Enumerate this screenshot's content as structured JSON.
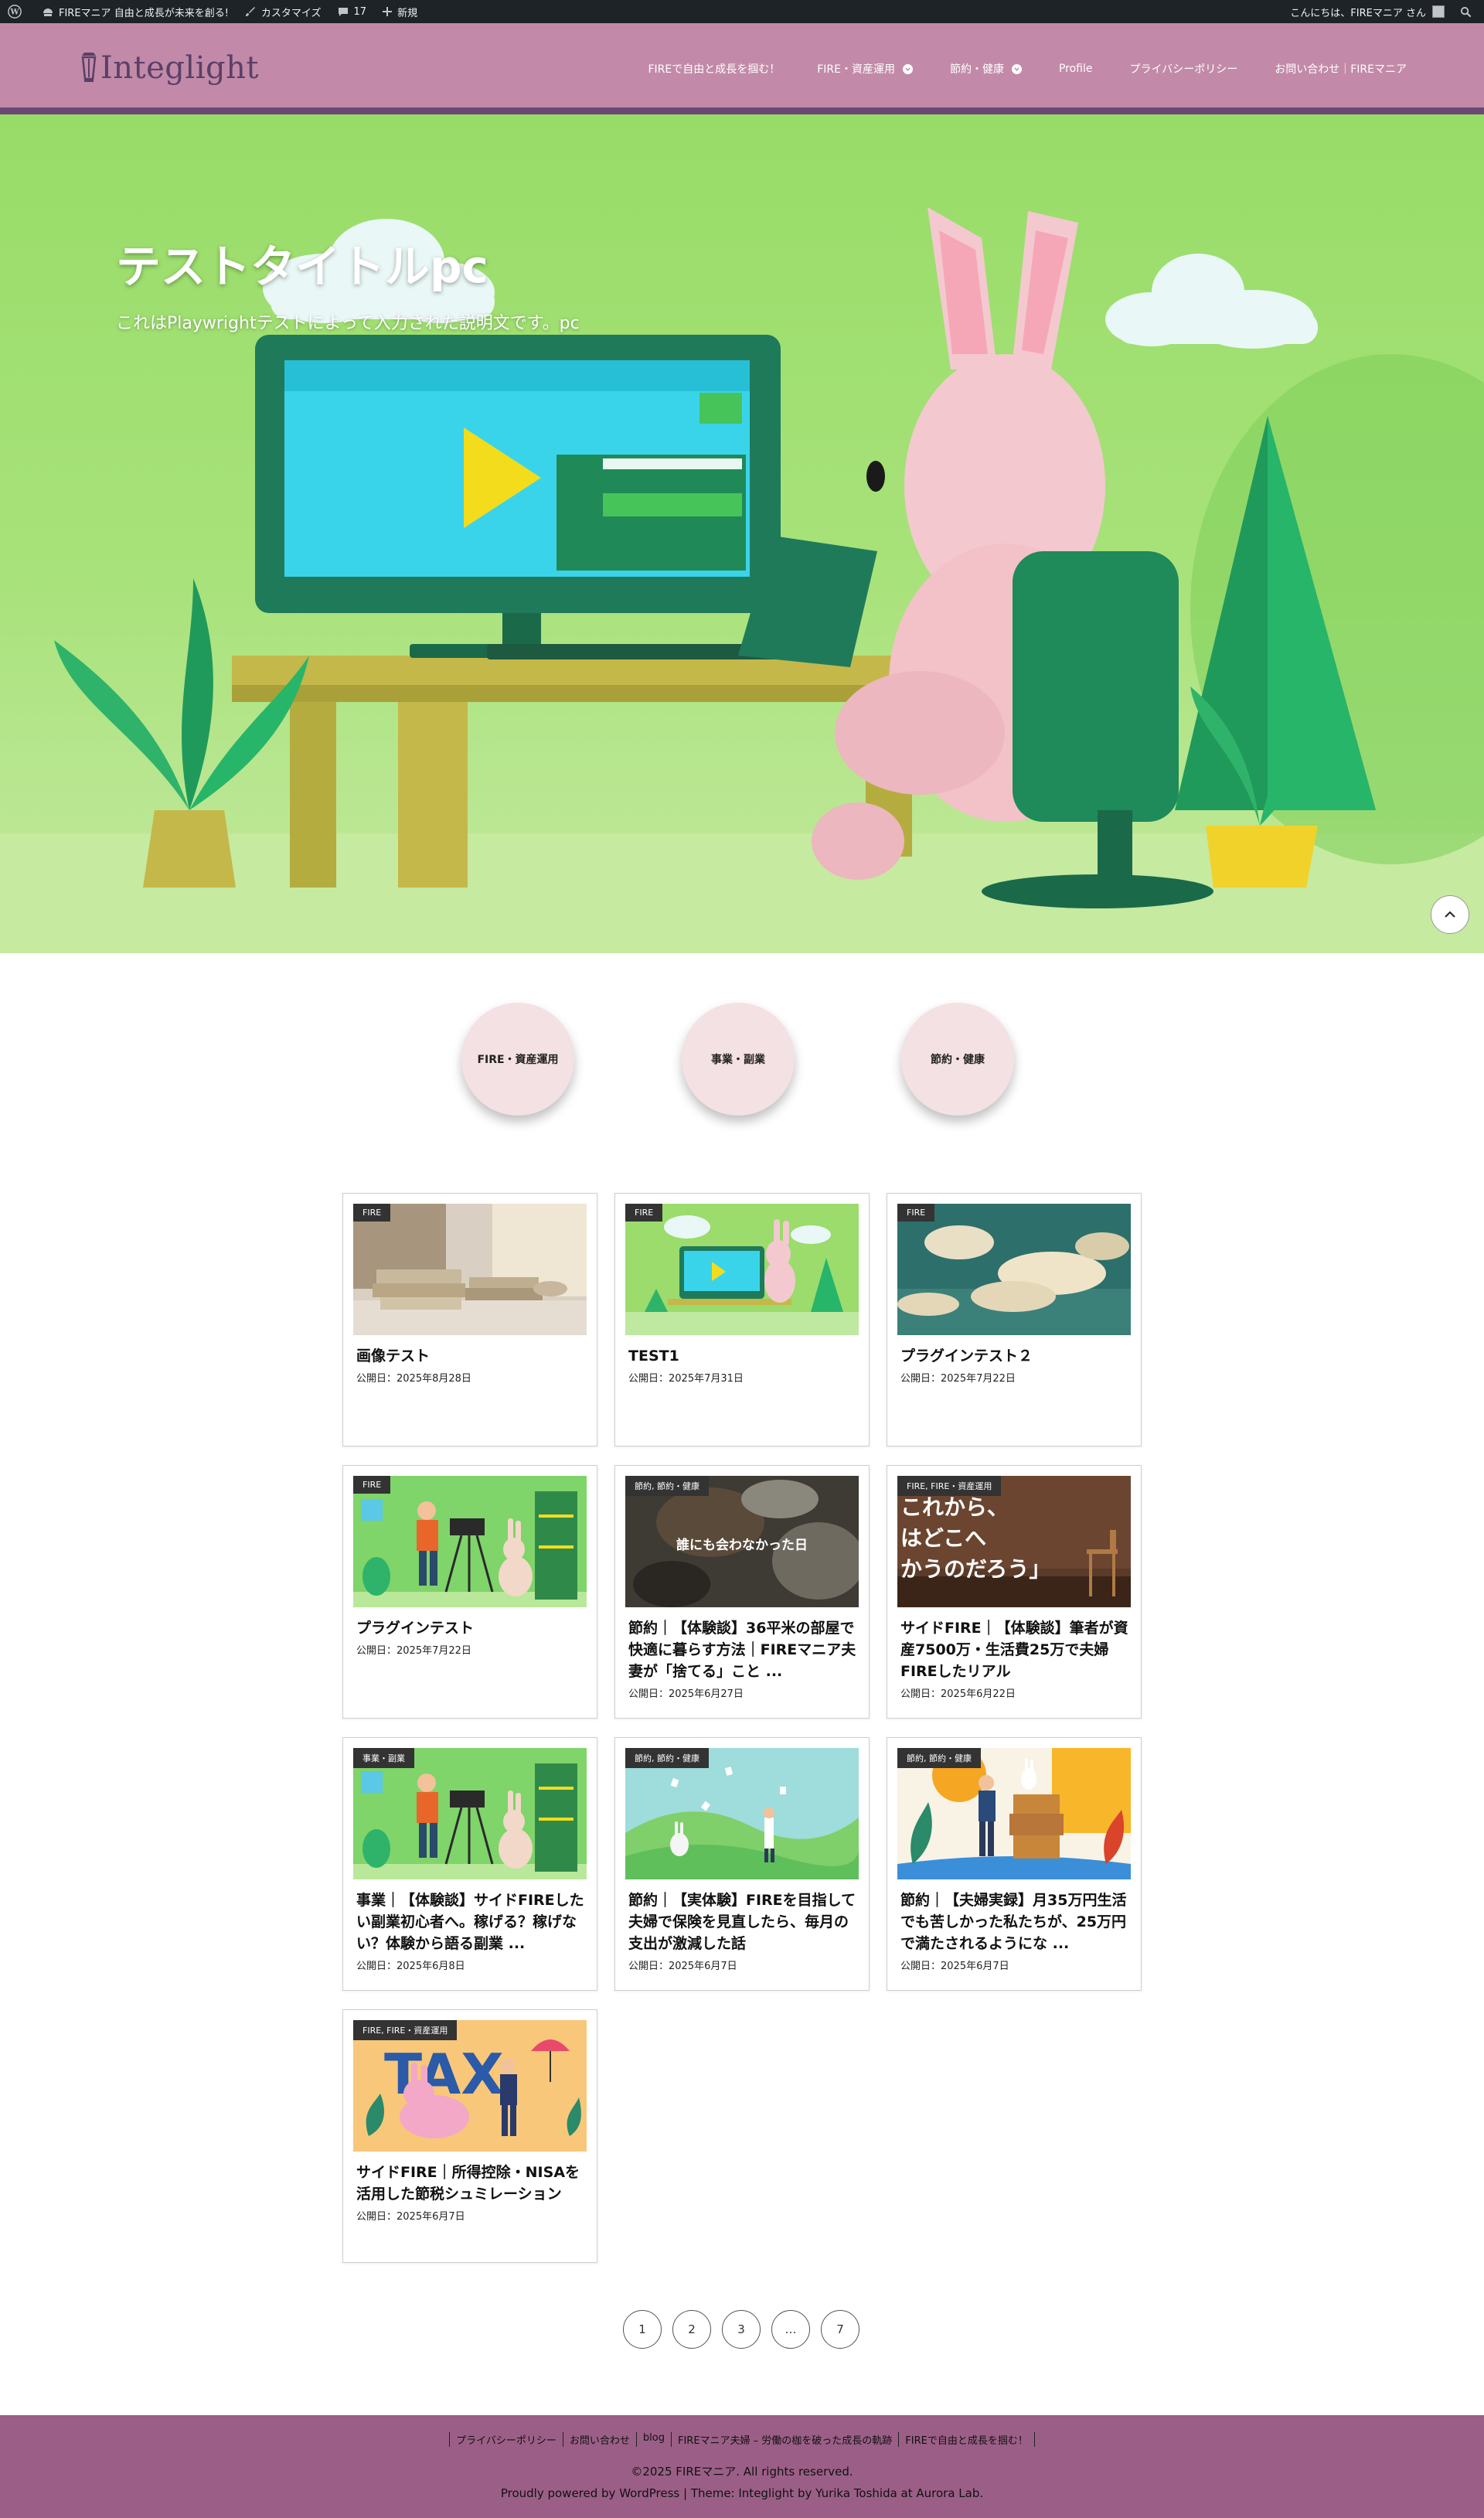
{
  "adminbar": {
    "site_name": "FIREマニア 自由と成長が未来を創る!",
    "customize": "カスタマイズ",
    "comments_count": "17",
    "new_label": "新規",
    "greeting": "こんにちは、FIREマニア さん"
  },
  "header": {
    "logo": "Integlight",
    "nav": [
      {
        "label": "FIREで自由と成長を掴む！",
        "has_dropdown": false
      },
      {
        "label": "FIRE・資産運用",
        "has_dropdown": true
      },
      {
        "label": "節約・健康",
        "has_dropdown": true
      },
      {
        "label": "Profile",
        "has_dropdown": false
      },
      {
        "label": "プライバシーポリシー",
        "has_dropdown": false
      },
      {
        "label": "お問い合わせ｜FIREマニア",
        "has_dropdown": false
      }
    ]
  },
  "hero": {
    "title": "テストタイトルpc",
    "description": "これはPlaywrightテストによって入力された説明文です。pc"
  },
  "categories": [
    "FIRE・資産運用",
    "事業・副業",
    "節約・健康"
  ],
  "posts": [
    {
      "tag": "FIRE",
      "title": "画像テスト",
      "date": "公開日：2025年8月28日",
      "image": "books"
    },
    {
      "tag": "FIRE",
      "title": "TEST1",
      "date": "公開日：2025年7月31日",
      "image": "rabbit-computer"
    },
    {
      "tag": "FIRE",
      "title": "プラグインテスト２",
      "date": "公開日：2025年7月22日",
      "image": "clouds"
    },
    {
      "tag": "FIRE",
      "title": "プラグインテスト",
      "date": "公開日：2025年7月22日",
      "image": "camera-rabbit"
    },
    {
      "tag": "節約, 節約・健康",
      "title": "節約｜【体験談】36平米の部屋で快適に暮らす方法｜FIREマニア夫妻が「捨てる」こと ...",
      "date": "公開日：2025年6月27日",
      "image": "dark-text",
      "overlay": "誰にも会わなかった日"
    },
    {
      "tag": "FIRE, FIRE・資産運用",
      "title": "サイドFIRE｜【体験談】筆者が資産7500万・生活費25万で夫婦FIREしたリアル",
      "date": "公開日：2025年6月22日",
      "image": "chair",
      "overlay_lines": [
        "これから、",
        "はどこへ",
        "かうのだろう」"
      ]
    },
    {
      "tag": "事業・副業",
      "title": "事業｜【体験談】サイドFIREしたい副業初心者へ。稼げる？稼げない？体験から語る副業 ...",
      "date": "公開日：2025年6月8日",
      "image": "camera-rabbit"
    },
    {
      "tag": "節約, 節約・健康",
      "title": "節約｜【実体験】FIREを目指して夫婦で保険を見直したら、毎月の支出が激減した話",
      "date": "公開日：2025年6月7日",
      "image": "papers"
    },
    {
      "tag": "節約, 節約・健康",
      "title": "節約｜【夫婦実録】月35万円生活でも苦しかった私たちが、25万円で満たされるようにな ...",
      "date": "公開日：2025年6月7日",
      "image": "boxes"
    },
    {
      "tag": "FIRE, FIRE・資産運用",
      "title": "サイドFIRE｜所得控除・NISAを活用した節税シュミレーション",
      "date": "公開日：2025年6月7日",
      "image": "tax",
      "overlay": "TAX"
    }
  ],
  "pagination": [
    "1",
    "2",
    "3",
    "…",
    "7"
  ],
  "footer": {
    "links": [
      "プライバシーポリシー",
      "お問い合わせ",
      "blog",
      "FIREマニア夫婦 – 労働の枷を破った成長の軌跡",
      "FIREで自由と成長を掴む！"
    ],
    "copyright": "©2025 FIREマニア. All rights reserved.",
    "powered": "Proudly powered by WordPress | Theme: Integlight by Yurika Toshida at Aurora Lab."
  },
  "colors": {
    "header_bg": "#c28aa8",
    "header_border": "#6a4a74",
    "footer_bg": "#9b5f87",
    "circle_bg": "#f4e1e3",
    "tag_bg": "#333333"
  }
}
